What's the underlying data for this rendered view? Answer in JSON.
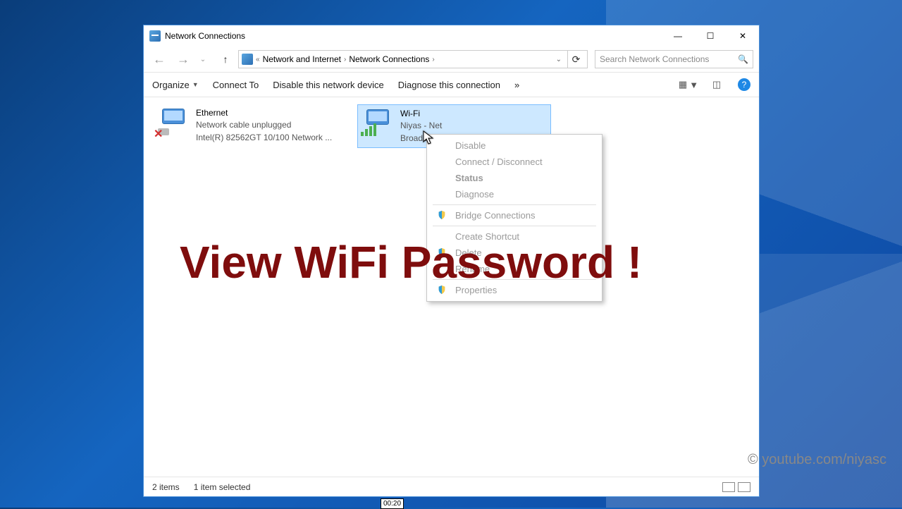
{
  "window": {
    "title": "Network Connections",
    "controls": {
      "min": "—",
      "max": "☐",
      "close": "✕"
    }
  },
  "address": {
    "prefix": "«",
    "crumb1": "Network and Internet",
    "crumb2": "Network Connections",
    "search_placeholder": "Search Network Connections"
  },
  "toolbar": {
    "organize": "Organize",
    "connect": "Connect To",
    "disable": "Disable this network device",
    "diagnose": "Diagnose this connection",
    "overflow": "»"
  },
  "connections": {
    "ethernet": {
      "name": "Ethernet",
      "status": "Network cable unplugged",
      "adapter": "Intel(R) 82562GT 10/100 Network ..."
    },
    "wifi": {
      "name": "Wi-Fi",
      "ssid": "Niyas - Net",
      "adapter": "Broadcom 802.11g Network Adap..."
    }
  },
  "context_menu": {
    "disable": "Disable",
    "connect_disconnect": "Connect / Disconnect",
    "status": "Status",
    "diagnose": "Diagnose",
    "bridge": "Bridge Connections",
    "shortcut": "Create Shortcut",
    "delete": "Delete",
    "rename": "Rename",
    "properties": "Properties"
  },
  "overlay": "View WiFi Password !",
  "watermark": "© youtube.com/niyasc",
  "statusbar": {
    "count": "2 items",
    "selected": "1 item selected"
  },
  "time_bubble": "00:20"
}
